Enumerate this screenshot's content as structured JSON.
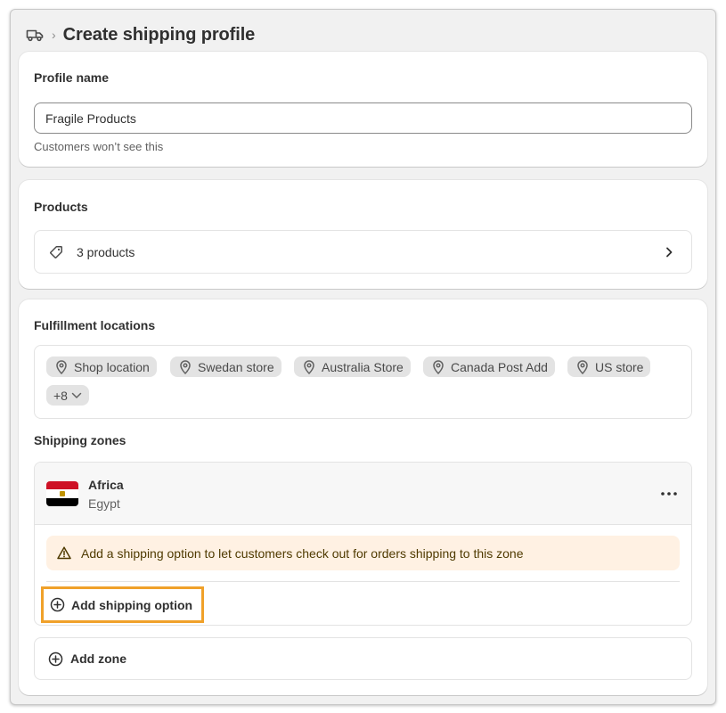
{
  "header": {
    "icon": "truck-icon",
    "title": "Create shipping profile"
  },
  "profile": {
    "title": "Profile name",
    "value": "Fragile Products",
    "help": "Customers won’t see this"
  },
  "products": {
    "title": "Products",
    "icon": "tag-icon",
    "label": "3 products"
  },
  "fulfillment": {
    "title": "Fulfillment locations",
    "locations": [
      "Shop location",
      "Swedan store",
      "Australia Store",
      "Canada Post Add",
      "US store"
    ],
    "more_label": "+8"
  },
  "zones": {
    "title": "Shipping zones",
    "zone": {
      "name": "Africa",
      "country": "Egypt",
      "flag_colors": [
        "#ce1126",
        "#ffffff",
        "#000000"
      ]
    },
    "warning": "Add a shipping option to let customers check out for orders shipping to this zone",
    "add_option_label": "Add shipping option",
    "add_zone_label": "Add zone"
  },
  "colors": {
    "highlight": "#f0a12a",
    "warning_bg": "#fff1e3",
    "chip_bg": "#e3e3e3"
  }
}
